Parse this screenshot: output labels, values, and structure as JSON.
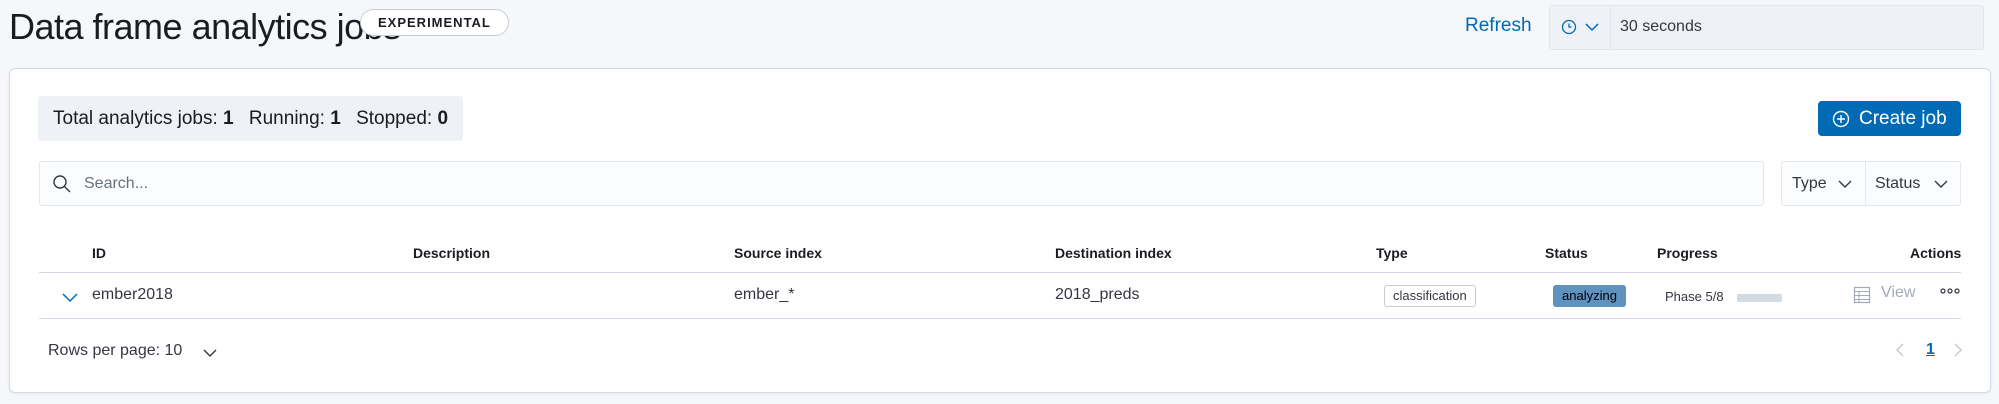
{
  "header": {
    "title": "Data frame analytics jobs",
    "badge": "EXPERIMENTAL",
    "refresh_label": "Refresh",
    "refresh_interval": "30 seconds",
    "refresh_icon": "clock-icon"
  },
  "stats": {
    "total_label": "Total analytics jobs:",
    "total_value": "1",
    "running_label": "Running:",
    "running_value": "1",
    "stopped_label": "Stopped:",
    "stopped_value": "0"
  },
  "create_button": {
    "label": "Create job",
    "icon": "plus-circle-icon"
  },
  "search": {
    "placeholder": "Search...",
    "value": ""
  },
  "filters": {
    "type_label": "Type",
    "status_label": "Status"
  },
  "table": {
    "columns": [
      "ID",
      "Description",
      "Source index",
      "Destination index",
      "Type",
      "Status",
      "Progress",
      "Actions"
    ],
    "rows": [
      {
        "id": "ember2018",
        "description": "",
        "source_index": "ember_*",
        "destination_index": "2018_preds",
        "type": "classification",
        "status": "analyzing",
        "progress_text": "Phase 5/8",
        "progress_fraction": 0.0,
        "view_label": "View"
      }
    ]
  },
  "pagination": {
    "rows_per_page": "Rows per page: 10",
    "current_page": "1"
  },
  "colors": {
    "accent": "#006bb4",
    "status_analyzing": "#6092c0",
    "panel_border": "#d3dae6"
  }
}
